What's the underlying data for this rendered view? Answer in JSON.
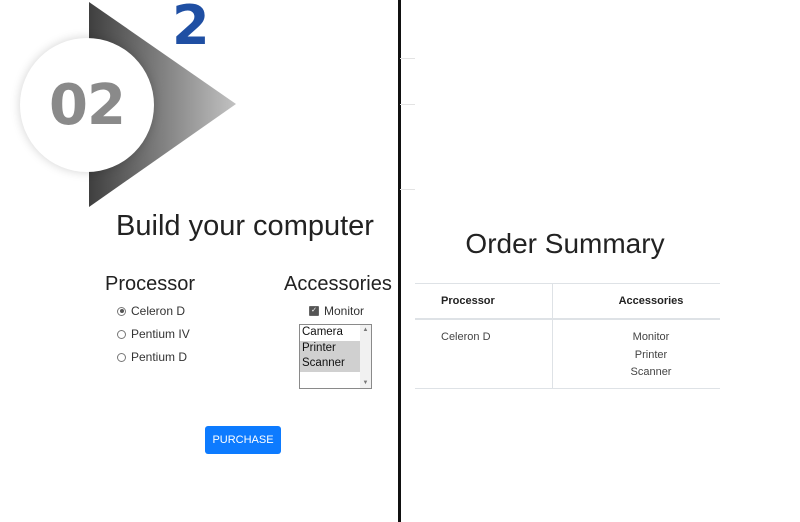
{
  "badge": {
    "number": "02",
    "step": "2"
  },
  "builder": {
    "title": "Build your computer",
    "processor_heading": "Processor",
    "processors": [
      {
        "label": "Celeron D",
        "selected": true
      },
      {
        "label": "Pentium IV",
        "selected": false
      },
      {
        "label": "Pentium D",
        "selected": false
      }
    ],
    "accessories_heading": "Accessories",
    "monitor_label": "Monitor",
    "monitor_checked": true,
    "options": [
      {
        "label": "Camera",
        "selected": false
      },
      {
        "label": "Printer",
        "selected": true
      },
      {
        "label": "Scanner",
        "selected": true
      }
    ],
    "purchase_label": "PURCHASE"
  },
  "summary": {
    "title": "Order Summary",
    "col_processor": "Processor",
    "col_accessories": "Accessories",
    "processor_value": "Celeron D",
    "accessories": [
      "Monitor",
      "Printer",
      "Scanner"
    ]
  },
  "colors": {
    "accent": "#0d7bff",
    "step_number": "#1f4fa3",
    "badge_text": "#8a8a8a"
  }
}
